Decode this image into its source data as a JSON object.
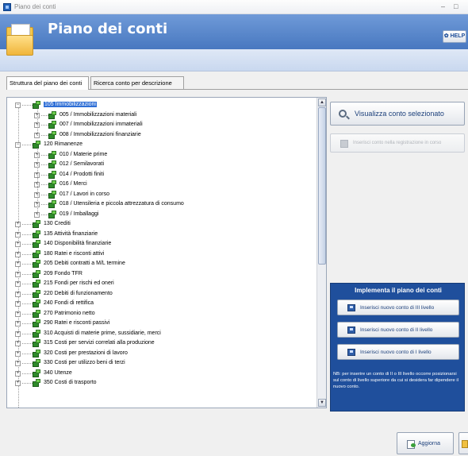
{
  "window": {
    "title": "Piano dei conti",
    "minimize_glyph": "–",
    "maximize_glyph": "□"
  },
  "banner": {
    "title": "Piano dei conti",
    "help_label": "HELP",
    "icon": "folder-document-icon"
  },
  "tabs": [
    {
      "label": "Struttura del piano dei conti",
      "active": true
    },
    {
      "label": "Ricerca conto per descrizione",
      "active": false
    }
  ],
  "tree": {
    "rows": [
      {
        "level": 0,
        "exp": "−",
        "label": "105 Immobilizzazioni",
        "selected": true
      },
      {
        "level": 1,
        "exp": "+",
        "label": "005 / Immobilizzazioni materiali"
      },
      {
        "level": 1,
        "exp": "+",
        "label": "007 / Immobilizzazioni immateriali"
      },
      {
        "level": 1,
        "exp": "+",
        "label": "008 / Immobilizzazioni finanziarie"
      },
      {
        "level": 0,
        "exp": "−",
        "label": "120 Rimanenze"
      },
      {
        "level": 1,
        "exp": "+",
        "label": "010 / Materie prime"
      },
      {
        "level": 1,
        "exp": "+",
        "label": "012 / Semilavorati"
      },
      {
        "level": 1,
        "exp": "+",
        "label": "014 / Prodotti finiti"
      },
      {
        "level": 1,
        "exp": "+",
        "label": "016 / Merci"
      },
      {
        "level": 1,
        "exp": "+",
        "label": "017 / Lavori in corso"
      },
      {
        "level": 1,
        "exp": "+",
        "label": "018 / Utensileria e piccola attrezzatura di consumo"
      },
      {
        "level": 1,
        "exp": "+",
        "label": "019 / Imballaggi"
      },
      {
        "level": 0,
        "exp": "+",
        "label": "130 Crediti"
      },
      {
        "level": 0,
        "exp": "+",
        "label": "135 Attività finanziarie"
      },
      {
        "level": 0,
        "exp": "+",
        "label": "140 Disponibilità finanziarie"
      },
      {
        "level": 0,
        "exp": "+",
        "label": "180 Ratei e risconti attivi"
      },
      {
        "level": 0,
        "exp": "+",
        "label": "205 Debiti contratti a M/L termine"
      },
      {
        "level": 0,
        "exp": "+",
        "label": "209 Fondo TFR"
      },
      {
        "level": 0,
        "exp": "+",
        "label": "215 Fondi per rischi ed oneri"
      },
      {
        "level": 0,
        "exp": "+",
        "label": "220 Debiti di funzionamento"
      },
      {
        "level": 0,
        "exp": "+",
        "label": "240 Fondi di rettifica"
      },
      {
        "level": 0,
        "exp": "+",
        "label": "270 Patrimonio netto"
      },
      {
        "level": 0,
        "exp": "+",
        "label": "290 Ratei e risconti passivi"
      },
      {
        "level": 0,
        "exp": "+",
        "label": "310 Acquisti di materie prime, sussidiarie, merci"
      },
      {
        "level": 0,
        "exp": "+",
        "label": "315 Costi per servizi correlati alla produzione"
      },
      {
        "level": 0,
        "exp": "+",
        "label": "320 Costi per prestazioni di lavoro"
      },
      {
        "level": 0,
        "exp": "+",
        "label": "330 Costi per utilizzo beni di terzi"
      },
      {
        "level": 0,
        "exp": "+",
        "label": "340 Utenze"
      },
      {
        "level": 0,
        "exp": "+",
        "label": "350 Costi di trasporto"
      }
    ],
    "scroll_up": "▲",
    "scroll_down": "▼"
  },
  "actions": {
    "view_selected": "Visualizza conto selezionato",
    "insert_disabled": "Inserisci conto nella registrazione in corso"
  },
  "implement": {
    "title": "Implementa il piano dei conti",
    "btn_level3": "Inserisci nuovo conto di III livello",
    "btn_level2": "Inserisci nuovo conto di II livello",
    "btn_level1": "Inserisci nuovo conto di I livello",
    "note": "NB: per inserire un conto di II o III livello occorre posizionarsi sul conto di livello superiore da cui si desidera far dipendere il nuovo conto."
  },
  "footer": {
    "update_label": "Aggiorna"
  },
  "colors": {
    "banner": "#4878c0",
    "panel": "#1f4f9c",
    "selection": "#2f6fd6"
  }
}
